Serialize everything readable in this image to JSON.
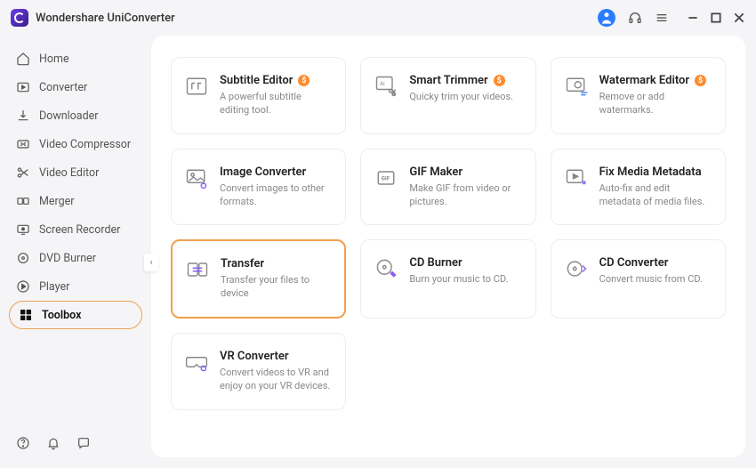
{
  "app": {
    "title": "Wondershare UniConverter"
  },
  "sidebar": {
    "items": [
      {
        "label": "Home"
      },
      {
        "label": "Converter"
      },
      {
        "label": "Downloader"
      },
      {
        "label": "Video Compressor"
      },
      {
        "label": "Video Editor"
      },
      {
        "label": "Merger"
      },
      {
        "label": "Screen Recorder"
      },
      {
        "label": "DVD Burner"
      },
      {
        "label": "Player"
      },
      {
        "label": "Toolbox"
      }
    ]
  },
  "toolbox": {
    "cards": [
      {
        "title": "Subtitle Editor",
        "desc": "A powerful subtitle editing tool.",
        "premium": true
      },
      {
        "title": "Smart Trimmer",
        "desc": "Quicky trim your videos.",
        "premium": true
      },
      {
        "title": "Watermark Editor",
        "desc": "Remove or add watermarks.",
        "premium": true
      },
      {
        "title": "Image Converter",
        "desc": "Convert images to other formats.",
        "premium": false
      },
      {
        "title": "GIF Maker",
        "desc": "Make GIF from video or pictures.",
        "premium": false
      },
      {
        "title": "Fix Media Metadata",
        "desc": "Auto-fix and edit metadata of media files.",
        "premium": false
      },
      {
        "title": "Transfer",
        "desc": "Transfer your files to device",
        "premium": false
      },
      {
        "title": "CD Burner",
        "desc": "Burn your music to CD.",
        "premium": false
      },
      {
        "title": "CD Converter",
        "desc": "Convert music from CD.",
        "premium": false
      },
      {
        "title": "VR Converter",
        "desc": "Convert videos to VR and enjoy on your VR devices.",
        "premium": false
      }
    ],
    "badge_symbol": "$"
  }
}
